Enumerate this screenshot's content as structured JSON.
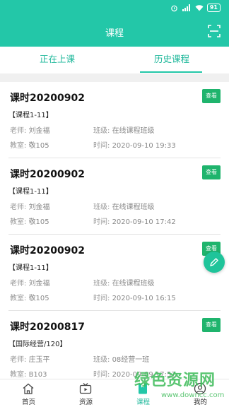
{
  "status_bar": {
    "battery": "91"
  },
  "header": {
    "title": "课程"
  },
  "tabs": [
    {
      "label": "正在上课"
    },
    {
      "label": "历史课程"
    }
  ],
  "courses": [
    {
      "title": "课时20200902",
      "course": "【课程1-11】",
      "teacher_label": "老师:",
      "teacher": "刘金福",
      "class_label": "班级:",
      "class": "在线课程班级",
      "room_label": "教室:",
      "room": "敬105",
      "time_label": "时间:",
      "time": "2020-09-10 19:33",
      "button": "查看"
    },
    {
      "title": "课时20200902",
      "course": "【课程1-11】",
      "teacher_label": "老师:",
      "teacher": "刘金福",
      "class_label": "班级:",
      "class": "在线课程班级",
      "room_label": "教室:",
      "room": "敬105",
      "time_label": "时间:",
      "time": "2020-09-10 17:42",
      "button": "查看"
    },
    {
      "title": "课时20200902",
      "course": "【课程1-11】",
      "teacher_label": "老师:",
      "teacher": "刘金福",
      "class_label": "班级:",
      "class": "在线课程班级",
      "room_label": "教室:",
      "room": "敬105",
      "time_label": "时间:",
      "time": "2020-09-10 16:15",
      "button": "查看"
    },
    {
      "title": "课时20200817",
      "course": "【国际经营/120】",
      "teacher_label": "老师:",
      "teacher": "庄玉平",
      "class_label": "班级:",
      "class": "08经营一班",
      "room_label": "教室:",
      "room": "B103",
      "time_label": "时间:",
      "time": "2020-09-09 17:57",
      "button": "查看"
    }
  ],
  "bottom_nav": [
    {
      "label": "首页",
      "icon": "home-icon"
    },
    {
      "label": "资源",
      "icon": "tv-icon"
    },
    {
      "label": "课程",
      "icon": "book-icon"
    },
    {
      "label": "我的",
      "icon": "user-icon"
    }
  ],
  "watermark": {
    "text": "绿色资源网",
    "url": "www.downcc.com"
  },
  "colors": {
    "primary": "#23c7a8",
    "button": "#1fb46d",
    "fab": "#1fc49a"
  }
}
